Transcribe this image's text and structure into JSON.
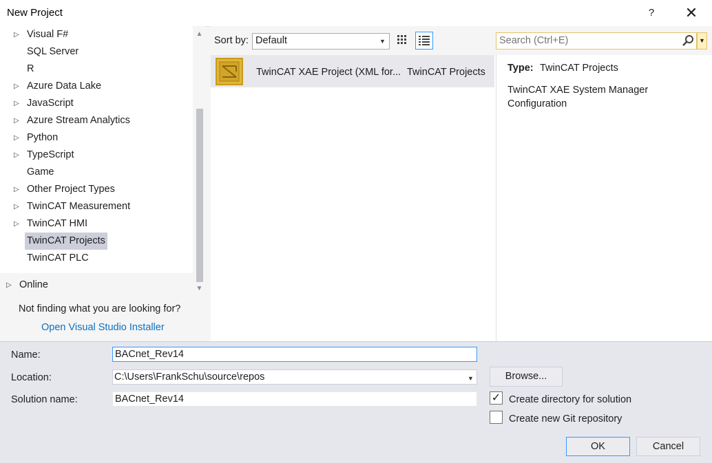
{
  "window": {
    "title": "New Project",
    "help_label": "?",
    "close_label": "✕"
  },
  "tree": {
    "items": [
      {
        "label": "Visual F#",
        "expandable": true
      },
      {
        "label": "SQL Server",
        "expandable": false
      },
      {
        "label": "R",
        "expandable": false
      },
      {
        "label": "Azure Data Lake",
        "expandable": true
      },
      {
        "label": "JavaScript",
        "expandable": true
      },
      {
        "label": "Azure Stream Analytics",
        "expandable": true
      },
      {
        "label": "Python",
        "expandable": true
      },
      {
        "label": "TypeScript",
        "expandable": true
      },
      {
        "label": "Game",
        "expandable": false
      },
      {
        "label": "Other Project Types",
        "expandable": true
      },
      {
        "label": "TwinCAT Measurement",
        "expandable": true
      },
      {
        "label": "TwinCAT HMI",
        "expandable": true
      },
      {
        "label": "TwinCAT Projects",
        "expandable": false,
        "selected": true
      },
      {
        "label": "TwinCAT PLC",
        "expandable": false
      }
    ],
    "online_label": "Online",
    "not_finding_text": "Not finding what you are looking for?",
    "installer_link": "Open Visual Studio Installer"
  },
  "sort": {
    "label": "Sort by:",
    "value": "Default"
  },
  "templates": [
    {
      "name": "TwinCAT XAE Project (XML for...",
      "type": "TwinCAT Projects"
    }
  ],
  "search": {
    "placeholder": "Search (Ctrl+E)"
  },
  "details": {
    "type_label": "Type:",
    "type_value": "TwinCAT Projects",
    "description": "TwinCAT XAE System Manager Configuration"
  },
  "form": {
    "name_label": "Name:",
    "name_value": "BACnet_Rev14",
    "location_label": "Location:",
    "location_value": "C:\\Users\\FrankSchu\\source\\repos",
    "solution_label": "Solution name:",
    "solution_value": "BACnet_Rev14",
    "browse_label": "Browse...",
    "create_dir_label": "Create directory for solution",
    "create_dir_checked": true,
    "git_label": "Create new Git repository",
    "git_checked": false,
    "ok_label": "OK",
    "cancel_label": "Cancel"
  },
  "colors": {
    "accent": "#3399ff",
    "selection": "#cccedb",
    "link": "#0e70c0",
    "icon_gold": "#d4a017"
  }
}
